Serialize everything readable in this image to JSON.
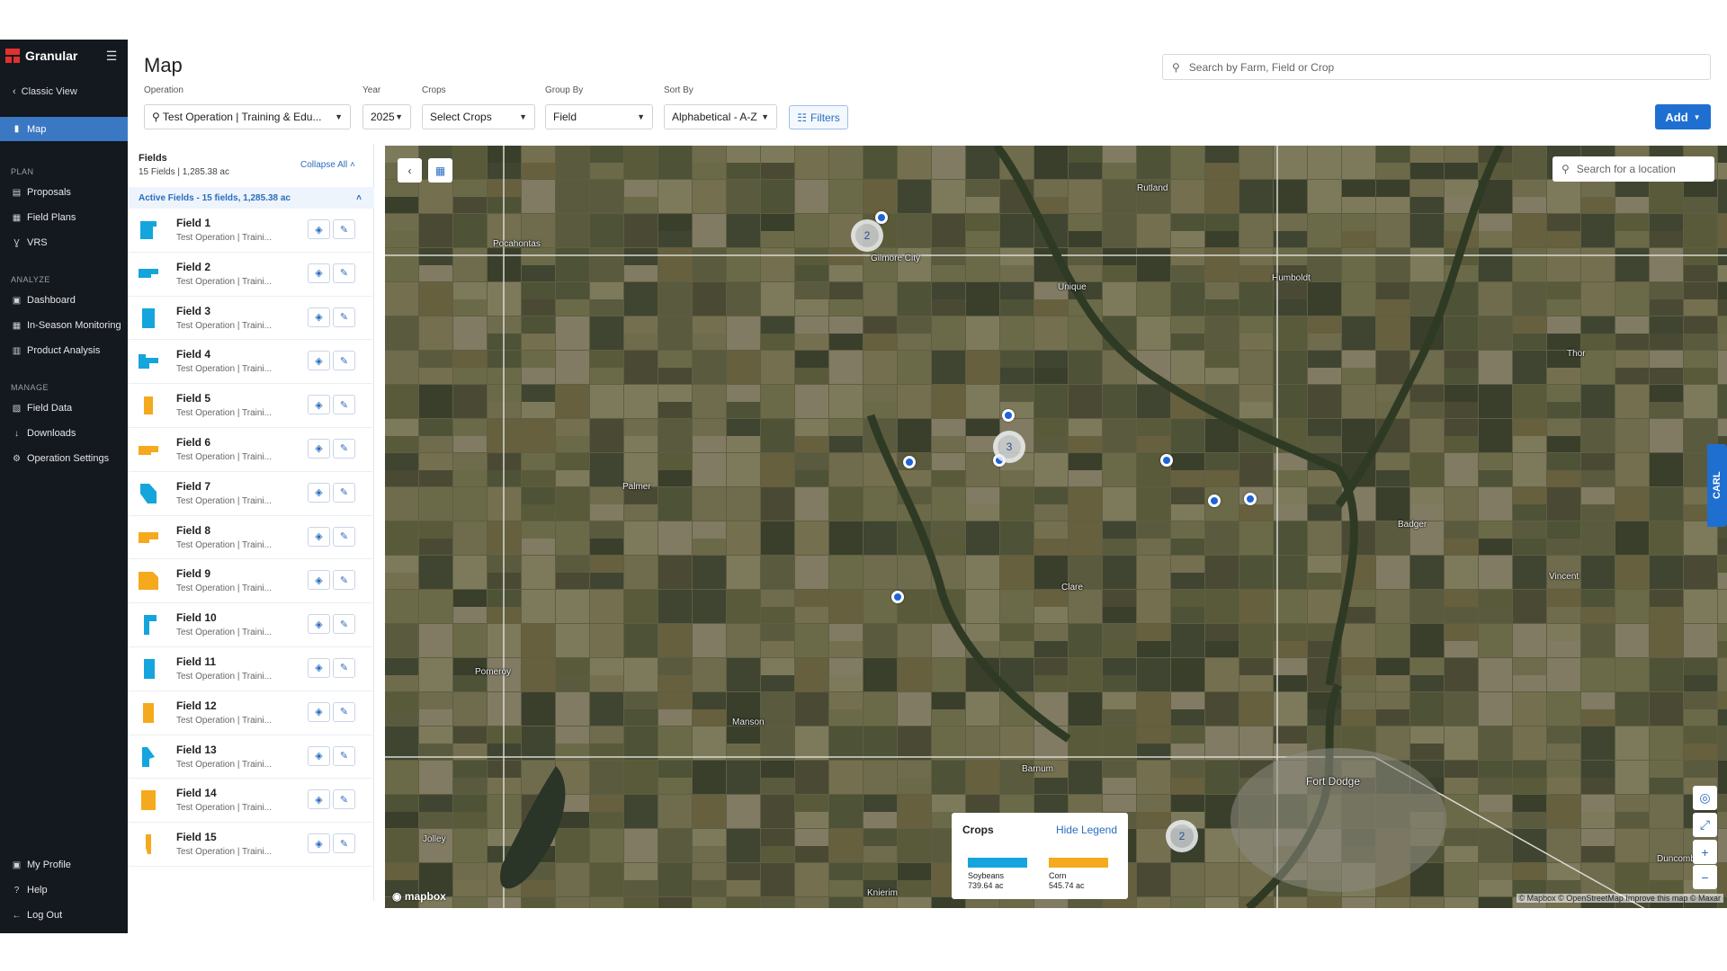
{
  "app": {
    "brand": "Granular",
    "classic_view": "Classic View",
    "page_title": "Map"
  },
  "sidebar": {
    "active_item": "Map",
    "sections": {
      "plan": "PLAN",
      "analyze": "ANALYZE",
      "manage": "MANAGE"
    },
    "plan_items": [
      "Proposals",
      "Field Plans",
      "VRS"
    ],
    "analyze_items": [
      "Dashboard",
      "In-Season Monitoring",
      "Product Analysis"
    ],
    "manage_items": [
      "Field Data",
      "Downloads",
      "Operation Settings"
    ],
    "footer_items": [
      "My Profile",
      "Help",
      "Log Out"
    ]
  },
  "search": {
    "placeholder": "Search by Farm, Field or Crop"
  },
  "filters": {
    "operation_label": "Operation",
    "operation_value": "Test Operation | Training & Edu...",
    "year_label": "Year",
    "year_value": "2025",
    "crops_label": "Crops",
    "crops_value": "Select Crops",
    "group_by_label": "Group By",
    "group_by_value": "Field",
    "sort_by_label": "Sort By",
    "sort_by_value": "Alphabetical - A-Z",
    "filters_button": "Filters",
    "add_button": "Add"
  },
  "fields_panel": {
    "title": "Fields",
    "summary": "15 Fields | 1,285.38 ac",
    "collapse_all": "Collapse All",
    "active_group": "Active Fields - 15 fields, 1,285.38 ac",
    "fields": [
      {
        "name": "Field 1",
        "operation": "Test Operation | Traini...",
        "crop": "soybeans"
      },
      {
        "name": "Field 2",
        "operation": "Test Operation | Traini...",
        "crop": "soybeans"
      },
      {
        "name": "Field 3",
        "operation": "Test Operation | Traini...",
        "crop": "soybeans"
      },
      {
        "name": "Field 4",
        "operation": "Test Operation | Traini...",
        "crop": "soybeans"
      },
      {
        "name": "Field 5",
        "operation": "Test Operation | Traini...",
        "crop": "corn"
      },
      {
        "name": "Field 6",
        "operation": "Test Operation | Traini...",
        "crop": "corn"
      },
      {
        "name": "Field 7",
        "operation": "Test Operation | Traini...",
        "crop": "soybeans"
      },
      {
        "name": "Field 8",
        "operation": "Test Operation | Traini...",
        "crop": "corn"
      },
      {
        "name": "Field 9",
        "operation": "Test Operation | Traini...",
        "crop": "corn"
      },
      {
        "name": "Field 10",
        "operation": "Test Operation | Traini...",
        "crop": "soybeans"
      },
      {
        "name": "Field 11",
        "operation": "Test Operation | Traini...",
        "crop": "soybeans"
      },
      {
        "name": "Field 12",
        "operation": "Test Operation | Traini...",
        "crop": "corn"
      },
      {
        "name": "Field 13",
        "operation": "Test Operation | Traini...",
        "crop": "soybeans"
      },
      {
        "name": "Field 14",
        "operation": "Test Operation | Traini...",
        "crop": "corn"
      },
      {
        "name": "Field 15",
        "operation": "Test Operation | Traini...",
        "crop": "corn"
      }
    ]
  },
  "map": {
    "location_placeholder": "Search for a location",
    "towns": [
      "Pocahontas",
      "Gilmore City",
      "Rutland",
      "Humboldt",
      "Unique",
      "Thor",
      "Palmer",
      "Badger",
      "Vincent",
      "Clare",
      "Pomeroy",
      "Manson",
      "Barnum",
      "Fort Dodge",
      "Jolley",
      "Knierim",
      "Duncombe"
    ],
    "cluster_counts": [
      "2",
      "3",
      "2"
    ],
    "carl_tab": "CARL",
    "attribution_logo": "mapbox",
    "attribution": "© Mapbox © OpenStreetMap Improve this map © Maxar"
  },
  "legend": {
    "title": "Crops",
    "hide": "Hide Legend",
    "items": [
      {
        "name": "Soybeans",
        "area": "739.64 ac",
        "color": "#14a5dc"
      },
      {
        "name": "Corn",
        "area": "545.74 ac",
        "color": "#f5a91c"
      }
    ]
  },
  "colors": {
    "sidebar_bg": "#14181f",
    "accent": "#1f6fd1",
    "active_nav": "#3a78c3",
    "soybeans": "#14a5dc",
    "corn": "#f5a91c"
  }
}
